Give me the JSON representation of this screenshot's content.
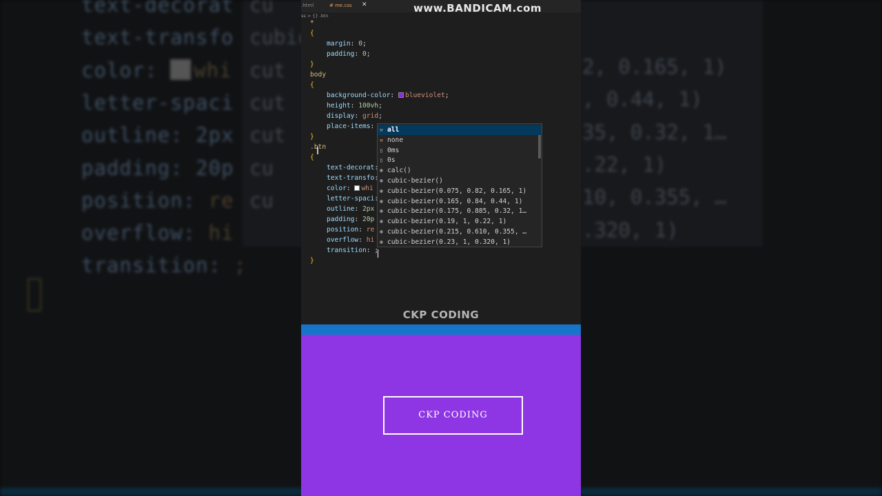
{
  "background": {
    "lines": [
      {
        "key": "text-decorat",
        "sep": ""
      },
      {
        "key": "text-transfo",
        "sep": ""
      },
      {
        "key": "color:",
        "sep": " ",
        "val": "whi"
      },
      {
        "key": "letter-spaci",
        "sep": ""
      },
      {
        "key": "outline: 2px",
        "sep": ""
      },
      {
        "key": "padding: 20p",
        "sep": ""
      },
      {
        "key": "position:",
        "sep": " ",
        "val": "re"
      },
      {
        "key": "overflow:",
        "sep": " ",
        "val": "hi"
      },
      {
        "key": "transition:",
        "sep": " ",
        "val": ";"
      }
    ],
    "right": [
      "cu",
      "cubic",
      "cut",
      "cut",
      "cut",
      "cu",
      "cu",
      "2, 0.165, 1)",
      ", 0.44, 1)",
      "35, 0.32, 1…",
      ".22, 1)",
      "10, 0.355, …",
      ".320, 1)"
    ]
  },
  "window": {
    "tabs": [
      {
        "label": ".html",
        "active": false
      },
      {
        "label": "# me.css",
        "active": true
      }
    ],
    "close_glyph": "✕",
    "breadcrumb": "ss > {} .btn",
    "watermark": "www.BANDICAM.com"
  },
  "code": {
    "lines": [
      {
        "text": "*",
        "kind": "sel"
      },
      {
        "text": "{",
        "kind": "brace"
      },
      {
        "prop": "margin",
        "value": "0"
      },
      {
        "prop": "padding",
        "value": "0"
      },
      {
        "text": "}",
        "kind": "brace"
      },
      {
        "text": "body",
        "kind": "sel"
      },
      {
        "text": "{",
        "kind": "brace"
      },
      {
        "prop": "background-color",
        "value": "blueviolet",
        "swatch": "#8a2be2"
      },
      {
        "prop": "height",
        "value": "100vh"
      },
      {
        "prop": "display",
        "value": "grid"
      },
      {
        "prop": "place-items",
        "value": ""
      },
      {
        "text": "}",
        "kind": "brace"
      },
      {
        "text": ".btn",
        "kind": "sel"
      },
      {
        "text": "{",
        "kind": "brace"
      },
      {
        "prop": "text-decorat",
        "value": ""
      },
      {
        "prop": "text-transfo",
        "value": ""
      },
      {
        "prop": "color",
        "value": "whi",
        "swatch": "#ffffff"
      },
      {
        "prop": "letter-spaci",
        "value": ""
      },
      {
        "prop": "outline",
        "value": "2px"
      },
      {
        "prop": "padding",
        "value": "20p"
      },
      {
        "prop": "position",
        "value": "re"
      },
      {
        "prop": "overflow",
        "value": "hi"
      },
      {
        "prop": "transition",
        "value": ";"
      },
      {
        "text": "}",
        "kind": "brace"
      }
    ]
  },
  "suggestions": {
    "items": [
      {
        "label": "all",
        "icon": "wrench-icon",
        "selected": true
      },
      {
        "label": "none",
        "icon": "wrench-icon",
        "selected": false
      },
      {
        "label": "0ms",
        "icon": "unit-icon",
        "selected": false
      },
      {
        "label": "0s",
        "icon": "unit-icon",
        "selected": false
      },
      {
        "label": "calc()",
        "icon": "function-icon",
        "selected": false
      },
      {
        "label": "cubic-bezier()",
        "icon": "function-icon",
        "selected": false
      },
      {
        "label": "cubic-bezier(0.075, 0.82, 0.165, 1)",
        "icon": "function-icon",
        "selected": false
      },
      {
        "label": "cubic-bezier(0.165, 0.84, 0.44, 1)",
        "icon": "function-icon",
        "selected": false
      },
      {
        "label": "cubic-bezier(0.175, 0.885, 0.32, 1…",
        "icon": "function-icon",
        "selected": false
      },
      {
        "label": "cubic-bezier(0.19, 1, 0.22, 1)",
        "icon": "function-icon",
        "selected": false
      },
      {
        "label": "cubic-bezier(0.215, 0.610, 0.355, …",
        "icon": "function-icon",
        "selected": false
      },
      {
        "label": "cubic-bezier(0.23, 1, 0.320, 1)",
        "icon": "function-icon",
        "selected": false
      }
    ]
  },
  "brand": {
    "text": "CKP CODING"
  },
  "preview": {
    "background": "#8e36e3",
    "button_label": "CKP CODING"
  },
  "colors": {
    "accent_blue": "#1874c9",
    "editor_bg": "#1e1e1e"
  }
}
